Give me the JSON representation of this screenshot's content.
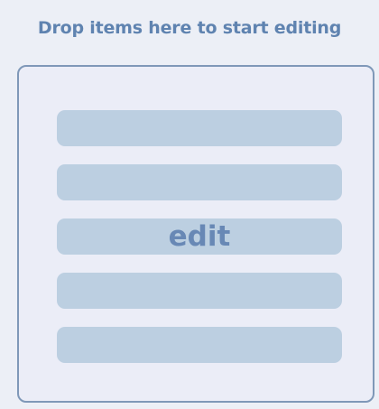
{
  "dropzone": {
    "instruction": "Drop items here to start editing",
    "edit_label": "edit"
  }
}
